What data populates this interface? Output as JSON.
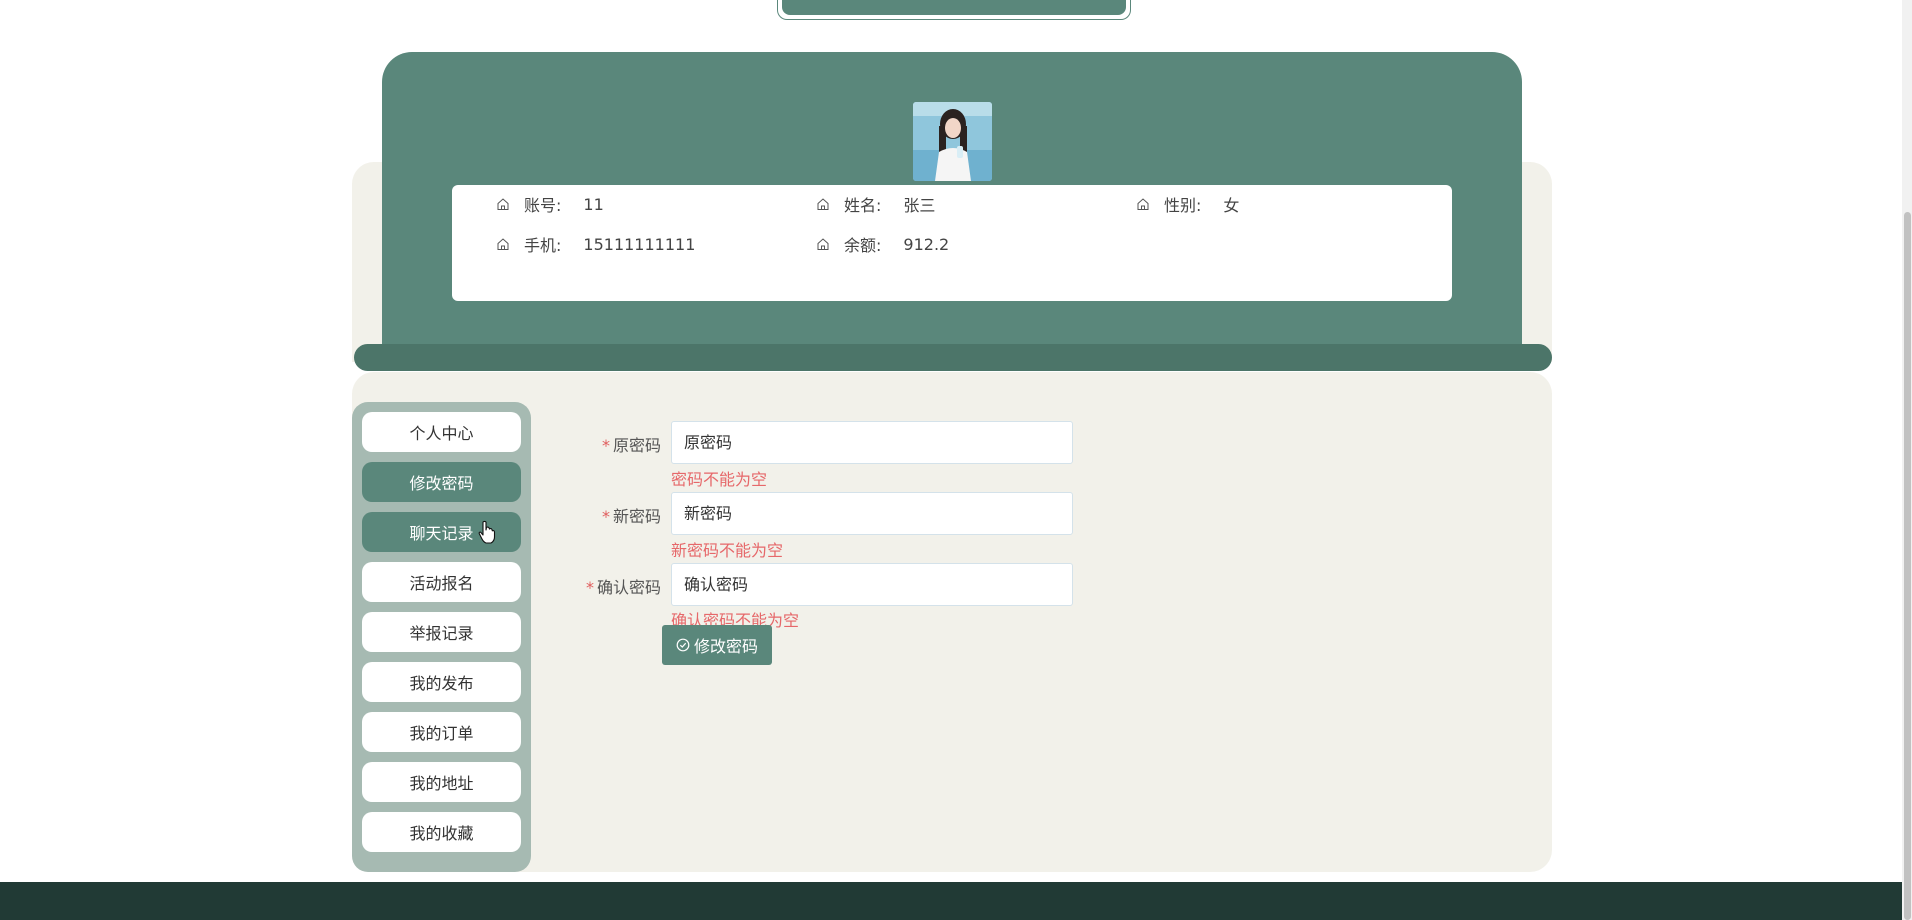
{
  "profile": {
    "fields": {
      "account": {
        "label": "账号:",
        "value": "11"
      },
      "name": {
        "label": "姓名:",
        "value": "张三"
      },
      "gender": {
        "label": "性别:",
        "value": "女"
      },
      "phone": {
        "label": "手机:",
        "value": "15111111111"
      },
      "balance": {
        "label": "余额:",
        "value": "912.2"
      }
    }
  },
  "menu": {
    "items": [
      {
        "label": "个人中心",
        "active": false
      },
      {
        "label": "修改密码",
        "active": true
      },
      {
        "label": "聊天记录",
        "active": true
      },
      {
        "label": "活动报名",
        "active": false
      },
      {
        "label": "举报记录",
        "active": false
      },
      {
        "label": "我的发布",
        "active": false
      },
      {
        "label": "我的订单",
        "active": false
      },
      {
        "label": "我的地址",
        "active": false
      },
      {
        "label": "我的收藏",
        "active": false
      }
    ]
  },
  "form": {
    "required_mark": "*",
    "old_password": {
      "label": "原密码",
      "placeholder": "原密码",
      "error": "密码不能为空"
    },
    "new_password": {
      "label": "新密码",
      "placeholder": "新密码",
      "error": "新密码不能为空"
    },
    "confirm_password": {
      "label": "确认密码",
      "placeholder": "确认密码",
      "error": "确认密码不能为空"
    },
    "submit_label": "修改密码"
  },
  "colors": {
    "primary": "#5a877b",
    "beige": "#f2f1ea",
    "menu_bg": "#a6bab2",
    "error": "#e6686a",
    "footer": "#213a35"
  }
}
